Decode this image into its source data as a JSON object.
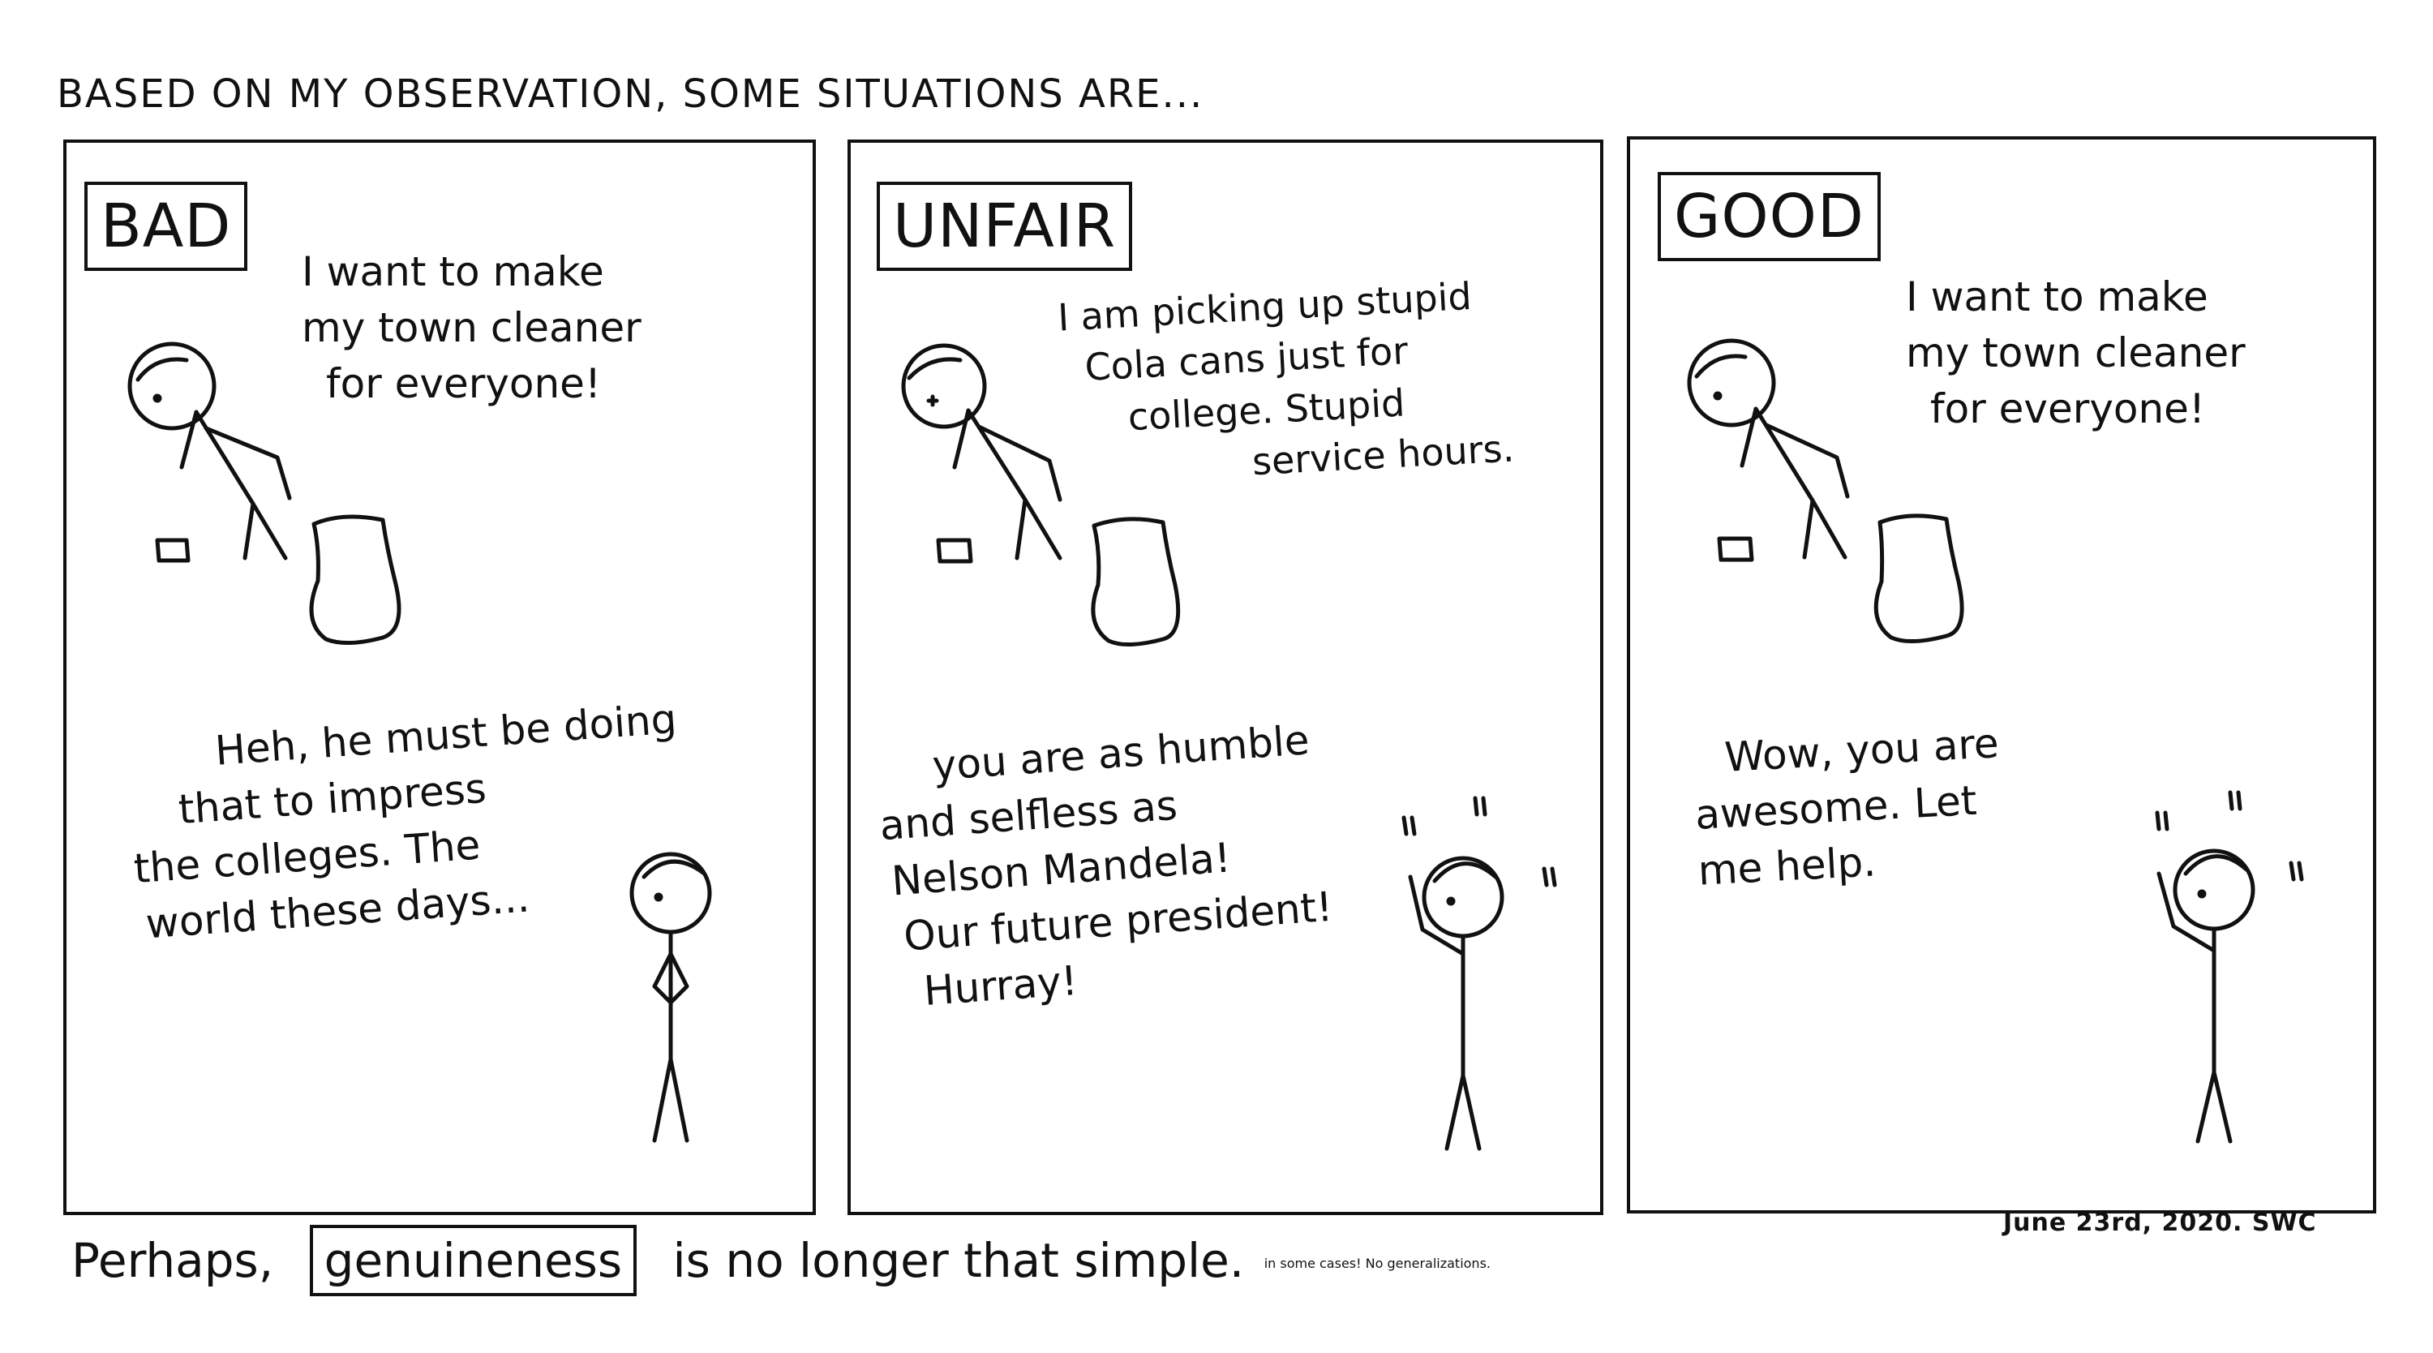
{
  "title": "BASED ON MY OBSERVATION, SOME SITUATIONS ARE...",
  "panels": [
    {
      "label": "BAD",
      "speech_top": [
        "I want to make",
        "my town cleaner",
        "for everyone!"
      ],
      "speech_bottom": [
        "Heh, he must be doing",
        "that to impress",
        "the colleges. The",
        "world these days..."
      ]
    },
    {
      "label": "UNFAIR",
      "speech_top": [
        "I am picking up stupid",
        "Cola cans just for",
        "college. Stupid",
        "service hours."
      ],
      "speech_bottom": [
        "you are as humble",
        "and selfless as",
        "Nelson Mandela!",
        "Our future president!",
        "Hurray!"
      ]
    },
    {
      "label": "GOOD",
      "speech_top": [
        "I want to make",
        "my town cleaner",
        "for everyone!"
      ],
      "speech_bottom": [
        "Wow, you are",
        "awesome. Let",
        "me help."
      ]
    }
  ],
  "footer": {
    "before": "Perhaps,",
    "boxed": "genuineness",
    "after": "is no longer that simple.",
    "note": "in some cases! No generalizations."
  },
  "date_signature": "June 23rd, 2020. SWC"
}
